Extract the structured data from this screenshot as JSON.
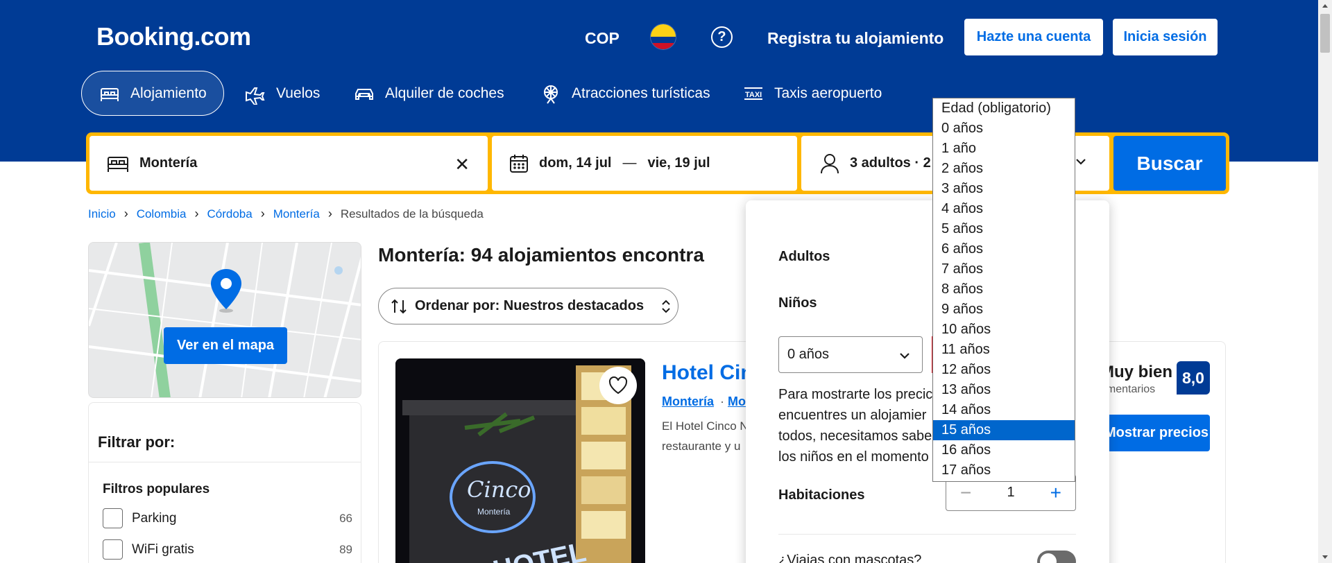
{
  "header": {
    "logo": "Booking.com",
    "currency": "COP",
    "help_icon": "?",
    "register_link": "Registra tu alojamiento",
    "signup_button": "Hazte una cuenta",
    "signin_button": "Inicia sesión"
  },
  "nav": {
    "items": [
      {
        "label": "Alojamiento",
        "icon": "bed-icon",
        "active": true
      },
      {
        "label": "Vuelos",
        "icon": "plane-icon"
      },
      {
        "label": "Alquiler de coches",
        "icon": "car-icon"
      },
      {
        "label": "Atracciones turísticas",
        "icon": "attractions-icon"
      },
      {
        "label": "Taxis aeropuerto",
        "icon": "taxi-icon"
      }
    ]
  },
  "search": {
    "destination": "Montería",
    "date_start": "dom, 14 jul",
    "date_sep": "—",
    "date_end": "vie, 19 jul",
    "occupancy": "3 adultos · 2",
    "button": "Buscar"
  },
  "breadcrumb": {
    "items": [
      "Inicio",
      "Colombia",
      "Córdoba",
      "Montería"
    ],
    "current": "Resultados de la búsqueda"
  },
  "map": {
    "button": "Ver en el mapa"
  },
  "filters": {
    "title": "Filtrar por:",
    "section": "Filtros populares",
    "items": [
      {
        "label": "Parking",
        "count": "66"
      },
      {
        "label": "WiFi gratis",
        "count": "89"
      }
    ]
  },
  "results": {
    "title": "Montería: 94 alojamientos encontra",
    "sort_label": "Ordenar por: Nuestros destacados"
  },
  "hotel": {
    "name": "Hotel Cin",
    "location_1": "Montería",
    "location_dot": "·",
    "location_2": "Mo",
    "desc_line1": "El Hotel Cinco N",
    "desc_line2": "restaurante y u",
    "rating_word": "Muy bien",
    "rating_sub": "omentarios",
    "score": "8,0",
    "prices_button": "Mostrar precios",
    "sign_text_1": "Cinco",
    "sign_text_2": "Montería",
    "sign_text_3": "HOTEL"
  },
  "occupancy_popup": {
    "adults_label": "Adultos",
    "children_label": "Niños",
    "child_age_value": "0 años",
    "description": [
      "Para mostrarte los precic",
      "encuentres un alojamier",
      "todos, necesitamos sabe",
      "los niños en el momento"
    ],
    "rooms_label": "Habitaciones",
    "rooms_value": "1",
    "minus": "−",
    "plus": "+",
    "pets_label": "¿Viajas con mascotas?"
  },
  "age_dropdown": {
    "options": [
      "Edad (obligatorio)",
      "0 años",
      "1 año",
      "2 años",
      "3 años",
      "4 años",
      "5 años",
      "6 años",
      "7 años",
      "8 años",
      "9 años",
      "10 años",
      "11 años",
      "12 años",
      "13 años",
      "14 años",
      "15 años",
      "16 años",
      "17 años"
    ],
    "selected": "15 años"
  },
  "colors": {
    "brand_blue": "#003b95",
    "action_blue": "#006ce4",
    "search_border": "#ffb700"
  }
}
